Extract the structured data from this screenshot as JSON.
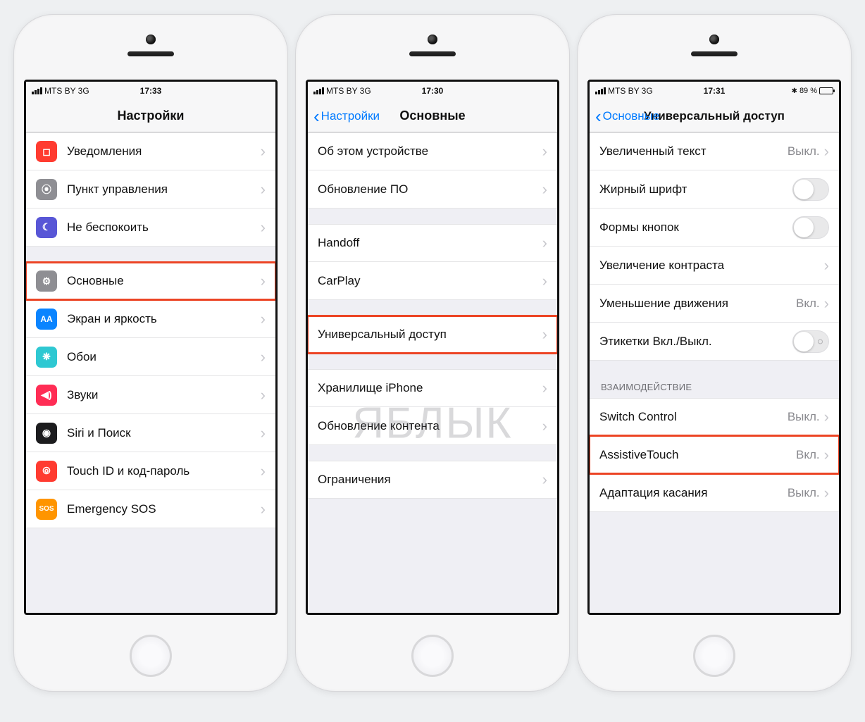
{
  "watermark": "ЯБЛЫК",
  "off_label": "Выкл.",
  "on_label": "Вкл.",
  "phone1": {
    "status": {
      "carrier": "MTS BY",
      "net": "3G",
      "time": "17:33"
    },
    "nav": {
      "title": "Настройки"
    },
    "group1": [
      {
        "icon_bg": "#ff3b30",
        "label": "Уведомления",
        "name": "notifications"
      },
      {
        "icon_bg": "#8e8e93",
        "label": "Пункт управления",
        "name": "control-center"
      },
      {
        "icon_bg": "#5856d6",
        "label": "Не беспокоить",
        "name": "dnd"
      }
    ],
    "group2": [
      {
        "icon_bg": "#8e8e93",
        "label": "Основные",
        "name": "general",
        "highlight": true
      },
      {
        "icon_bg": "#0a84ff",
        "label": "Экран и яркость",
        "name": "display"
      },
      {
        "icon_bg": "#2ec8d2",
        "label": "Обои",
        "name": "wallpaper"
      },
      {
        "icon_bg": "#ff2d55",
        "label": "Звуки",
        "name": "sounds"
      },
      {
        "icon_bg": "#1c1c1e",
        "label": "Siri и Поиск",
        "name": "siri"
      },
      {
        "icon_bg": "#ff3b30",
        "label": "Touch ID и код-пароль",
        "name": "touchid"
      },
      {
        "icon_bg": "#ff9500",
        "label": "Emergency SOS",
        "name": "sos",
        "icon_text": "SOS"
      }
    ]
  },
  "phone2": {
    "status": {
      "carrier": "MTS BY",
      "net": "3G",
      "time": "17:30"
    },
    "nav": {
      "back": "Настройки",
      "title": "Основные"
    },
    "group1": [
      {
        "label": "Об этом устройстве",
        "name": "about"
      },
      {
        "label": "Обновление ПО",
        "name": "software-update"
      }
    ],
    "group2": [
      {
        "label": "Handoff",
        "name": "handoff"
      },
      {
        "label": "CarPlay",
        "name": "carplay"
      }
    ],
    "group3": [
      {
        "label": "Универсальный доступ",
        "name": "accessibility",
        "highlight": true
      }
    ],
    "group4": [
      {
        "label": "Хранилище iPhone",
        "name": "storage"
      },
      {
        "label": "Обновление контента",
        "name": "background-refresh"
      }
    ],
    "group5": [
      {
        "label": "Ограничения",
        "name": "restrictions"
      }
    ]
  },
  "phone3": {
    "status": {
      "carrier": "MTS BY",
      "net": "3G",
      "time": "17:31",
      "battery": "89 %"
    },
    "nav": {
      "back": "Основные",
      "title": "Универсальный доступ"
    },
    "group1": [
      {
        "label": "Увеличенный текст",
        "name": "larger-text",
        "value_key": "off_label"
      },
      {
        "label": "Жирный шрифт",
        "name": "bold-text",
        "toggle": true
      },
      {
        "label": "Формы кнопок",
        "name": "button-shapes",
        "toggle": true
      },
      {
        "label": "Увеличение контраста",
        "name": "increase-contrast"
      },
      {
        "label": "Уменьшение движения",
        "name": "reduce-motion",
        "value_key": "on_label"
      },
      {
        "label": "Этикетки Вкл./Выкл.",
        "name": "onoff-labels",
        "toggle": true,
        "indicator": true
      }
    ],
    "section2_header": "ВЗАИМОДЕЙСТВИЕ",
    "group2": [
      {
        "label": "Switch Control",
        "name": "switch-control",
        "value_key": "off_label"
      },
      {
        "label": "AssistiveTouch",
        "name": "assistivetouch",
        "value_key": "on_label",
        "highlight": true
      },
      {
        "label": "Адаптация касания",
        "name": "touch-accommodations",
        "value_key": "off_label"
      }
    ]
  },
  "icons": {
    "notifications": "◻︎",
    "control-center": "⦿",
    "dnd": "☾",
    "general": "⚙︎",
    "display": "AA",
    "wallpaper": "❋",
    "sounds": "◀︎)",
    "siri": "◉",
    "touchid": "⦾"
  }
}
